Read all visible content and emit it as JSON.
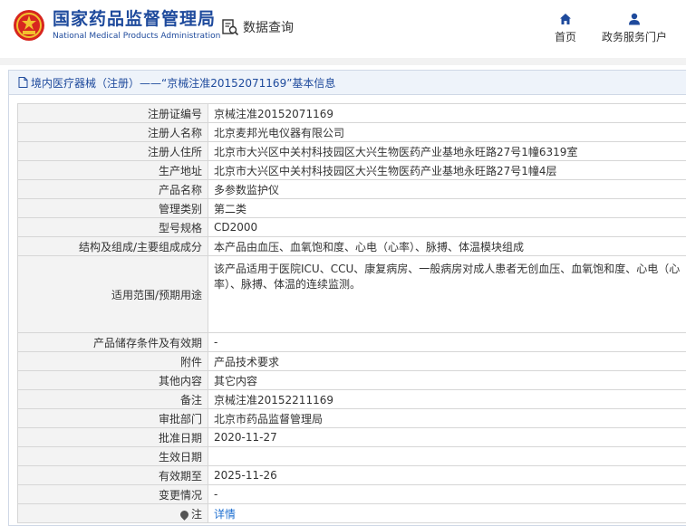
{
  "header": {
    "logo_cn": "国家药品监督管理局",
    "logo_en": "National Medical Products Administration",
    "query_label": "数据查询",
    "nav": [
      {
        "label": "首页",
        "icon": "home-icon"
      },
      {
        "label": "政务服务门户",
        "icon": "user-icon"
      }
    ]
  },
  "colors": {
    "brand_blue": "#1e4a9c",
    "emblem_red": "#d7261f",
    "emblem_gold": "#f2c12e",
    "link_blue": "#1e6fd0"
  },
  "panel": {
    "title": "境内医疗器械（注册）——“京械注准20152071169”基本信息"
  },
  "rows": [
    {
      "label": "注册证编号",
      "value": "京械注准20152071169"
    },
    {
      "label": "注册人名称",
      "value": "北京麦邦光电仪器有限公司"
    },
    {
      "label": "注册人住所",
      "value": "北京市大兴区中关村科技园区大兴生物医药产业基地永旺路27号1幢6319室"
    },
    {
      "label": "生产地址",
      "value": "北京市大兴区中关村科技园区大兴生物医药产业基地永旺路27号1幢4层"
    },
    {
      "label": "产品名称",
      "value": "多参数监护仪"
    },
    {
      "label": "管理类别",
      "value": "第二类"
    },
    {
      "label": "型号规格",
      "value": "CD2000"
    },
    {
      "label": "结构及组成/主要组成成分",
      "value": "本产品由血压、血氧饱和度、心电（心率）、脉搏、体温模块组成"
    },
    {
      "label": "适用范围/预期用途",
      "value": "该产品适用于医院ICU、CCU、康复病房、一般病房对成人患者无创血压、血氧饱和度、心电（心率）、脉搏、体温的连续监测。"
    },
    {
      "label": "产品储存条件及有效期",
      "value": "-"
    },
    {
      "label": "附件",
      "value": "产品技术要求"
    },
    {
      "label": "其他内容",
      "value": "其它内容"
    },
    {
      "label": "备注",
      "value": "京械注准20152211169"
    },
    {
      "label": "审批部门",
      "value": "北京市药品监督管理局"
    },
    {
      "label": "批准日期",
      "value": "2020-11-27"
    },
    {
      "label": "生效日期",
      "value": ""
    },
    {
      "label": "有效期至",
      "value": "2025-11-26"
    },
    {
      "label": "变更情况",
      "value": "-"
    }
  ],
  "note_row": {
    "label": "注",
    "link": "详情"
  }
}
